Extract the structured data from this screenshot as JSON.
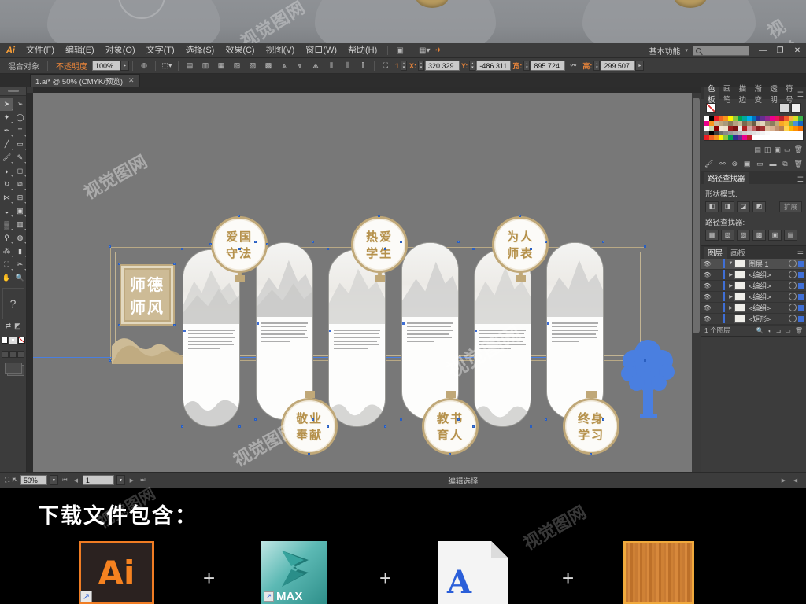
{
  "preview": {
    "watermark": "视觉图网"
  },
  "app": {
    "logo": "Ai",
    "menus": [
      {
        "label": "文件(F)"
      },
      {
        "label": "编辑(E)"
      },
      {
        "label": "对象(O)"
      },
      {
        "label": "文字(T)"
      },
      {
        "label": "选择(S)"
      },
      {
        "label": "效果(C)"
      },
      {
        "label": "视图(V)"
      },
      {
        "label": "窗口(W)"
      },
      {
        "label": "帮助(H)"
      }
    ],
    "workspace": "基本功能",
    "search_placeholder": "",
    "window_buttons": {
      "minimize": "—",
      "restore": "❐",
      "close": "✕"
    }
  },
  "control_bar": {
    "object_type": "混合对象",
    "opacity_label": "不透明度",
    "opacity_value": "100%",
    "x_label": "X:",
    "x_value": "320.329",
    "y_label": "Y:",
    "y_value": "-486.311",
    "w_label": "宽:",
    "w_value": "895.724",
    "h_label": "高:",
    "h_value": "299.507",
    "count_label": "1"
  },
  "document_tab": {
    "title": "1.ai* @ 50% (CMYK/预览)",
    "close": "✕"
  },
  "artwork": {
    "title_block": {
      "line1": "师德",
      "line2": "师风"
    },
    "badges": [
      {
        "id": "badge-aiguo-shoufa",
        "line1": "爱国",
        "line2": "守法",
        "position": "top"
      },
      {
        "id": "badge-jingye-fengxian",
        "line1": "敬业",
        "line2": "奉献",
        "position": "bottom"
      },
      {
        "id": "badge-reai-xuesheng",
        "line1": "热爱",
        "line2": "学生",
        "position": "top"
      },
      {
        "id": "badge-jiaoshu-yuren",
        "line1": "教书",
        "line2": "育人",
        "position": "bottom"
      },
      {
        "id": "badge-weiren-shibiao",
        "line1": "为人",
        "line2": "师表",
        "position": "top"
      },
      {
        "id": "badge-zhongshen-xuexi",
        "line1": "终身",
        "line2": "学习",
        "position": "bottom"
      }
    ],
    "panel_count": 6,
    "watermark": "视觉图网"
  },
  "panels": {
    "swatches": {
      "tabs": [
        "色板",
        "画笔",
        "描边",
        "渐变",
        "透明",
        "符号"
      ],
      "active": "色板",
      "colors": [
        "#ffffff",
        "#000000",
        "#ed1c24",
        "#f26522",
        "#f7941e",
        "#fff200",
        "#8dc63f",
        "#00a651",
        "#00a99d",
        "#00aeef",
        "#0072bc",
        "#2e3192",
        "#662d91",
        "#92278f",
        "#ec008c",
        "#ed145b",
        "#be1e2d",
        "#f15a29",
        "#fbb040",
        "#d7df23",
        "#39b54a",
        "#ec008c",
        "#f7941e",
        "#c8b89a",
        "#bda87e",
        "#a89a7c",
        "#8a7b5c",
        "#b5a183",
        "#c9b896",
        "#7a6a4f",
        "#9c8b6a",
        "#6b5d45",
        "#d4c4a8",
        "#e2d5bb",
        "#a0906f",
        "#8c7d5e",
        "#c0a878",
        "#f9a825",
        "#fbc02d",
        "#7cb342",
        "#4a90d9",
        "#1565c0",
        "#ffffff",
        "#c8d8b0",
        "#8c0000",
        "#f2e8d8",
        "#efe4cc",
        "#9c1c1c",
        "#7a1010",
        "#e8e8e8",
        "#b02020",
        "#d4a5a5",
        "#c06060",
        "#8b2020",
        "#a03030",
        "#e0c0a0",
        "#d8b090",
        "#c09070",
        "#b88050",
        "#ffd54f",
        "#ffb300",
        "#ff8f00",
        "#ef6c00",
        "#5a5a5a",
        "#000000",
        "#3c3c3c",
        "#6e6e6e",
        "#888888",
        "#9a9a9a",
        "#ababab",
        "#bcbcbc",
        "#cccccc",
        "#d6d6d6",
        "#e0e0e0",
        "#eaeaea",
        "#f2f2f2",
        "#fafafa",
        "#ffffff",
        "#ffffff",
        "#ffffff",
        "#ffffff",
        "#ffffff",
        "#ffffff",
        "#ffffff",
        "#ed1c24",
        "#f26522",
        "#f7941e",
        "#fff200",
        "#8dc63f",
        "#00a651",
        "#2e3192",
        "#662d91",
        "#ec008c",
        "#be1e2d",
        "#ffffff",
        "#ffffff",
        "#ffffff",
        "#ffffff",
        "#ffffff",
        "#ffffff",
        "#ffffff",
        "#ffffff",
        "#ffffff",
        "#ffffff",
        "#ffffff"
      ]
    },
    "pathfinder": {
      "title": "路径查找器",
      "shape_modes_label": "形状模式:",
      "pathfinders_label": "路径查找器:",
      "expand_label": "扩展"
    },
    "layers": {
      "tabs": [
        "图层",
        "画板"
      ],
      "active": "图层",
      "rows": [
        {
          "name": "图层 1",
          "selected": true
        },
        {
          "name": "<编组>",
          "selected": false
        },
        {
          "name": "<编组>",
          "selected": false
        },
        {
          "name": "<编组>",
          "selected": false
        },
        {
          "name": "<编组>",
          "selected": false
        },
        {
          "name": "<矩形>",
          "selected": false
        }
      ],
      "footer_count": "1 个图层"
    }
  },
  "status_bar": {
    "zoom": "50%",
    "page": "1",
    "tool_status": "编辑选择"
  },
  "footer": {
    "title": "下载文件包含：",
    "separator": "+",
    "items": [
      {
        "name": "ai-file-icon",
        "label": "Ai"
      },
      {
        "name": "max-file-icon",
        "label": "MAX"
      },
      {
        "name": "font-file-icon",
        "label": "A"
      },
      {
        "name": "texture-file-icon",
        "label": ""
      }
    ],
    "watermark": "视觉图网"
  }
}
